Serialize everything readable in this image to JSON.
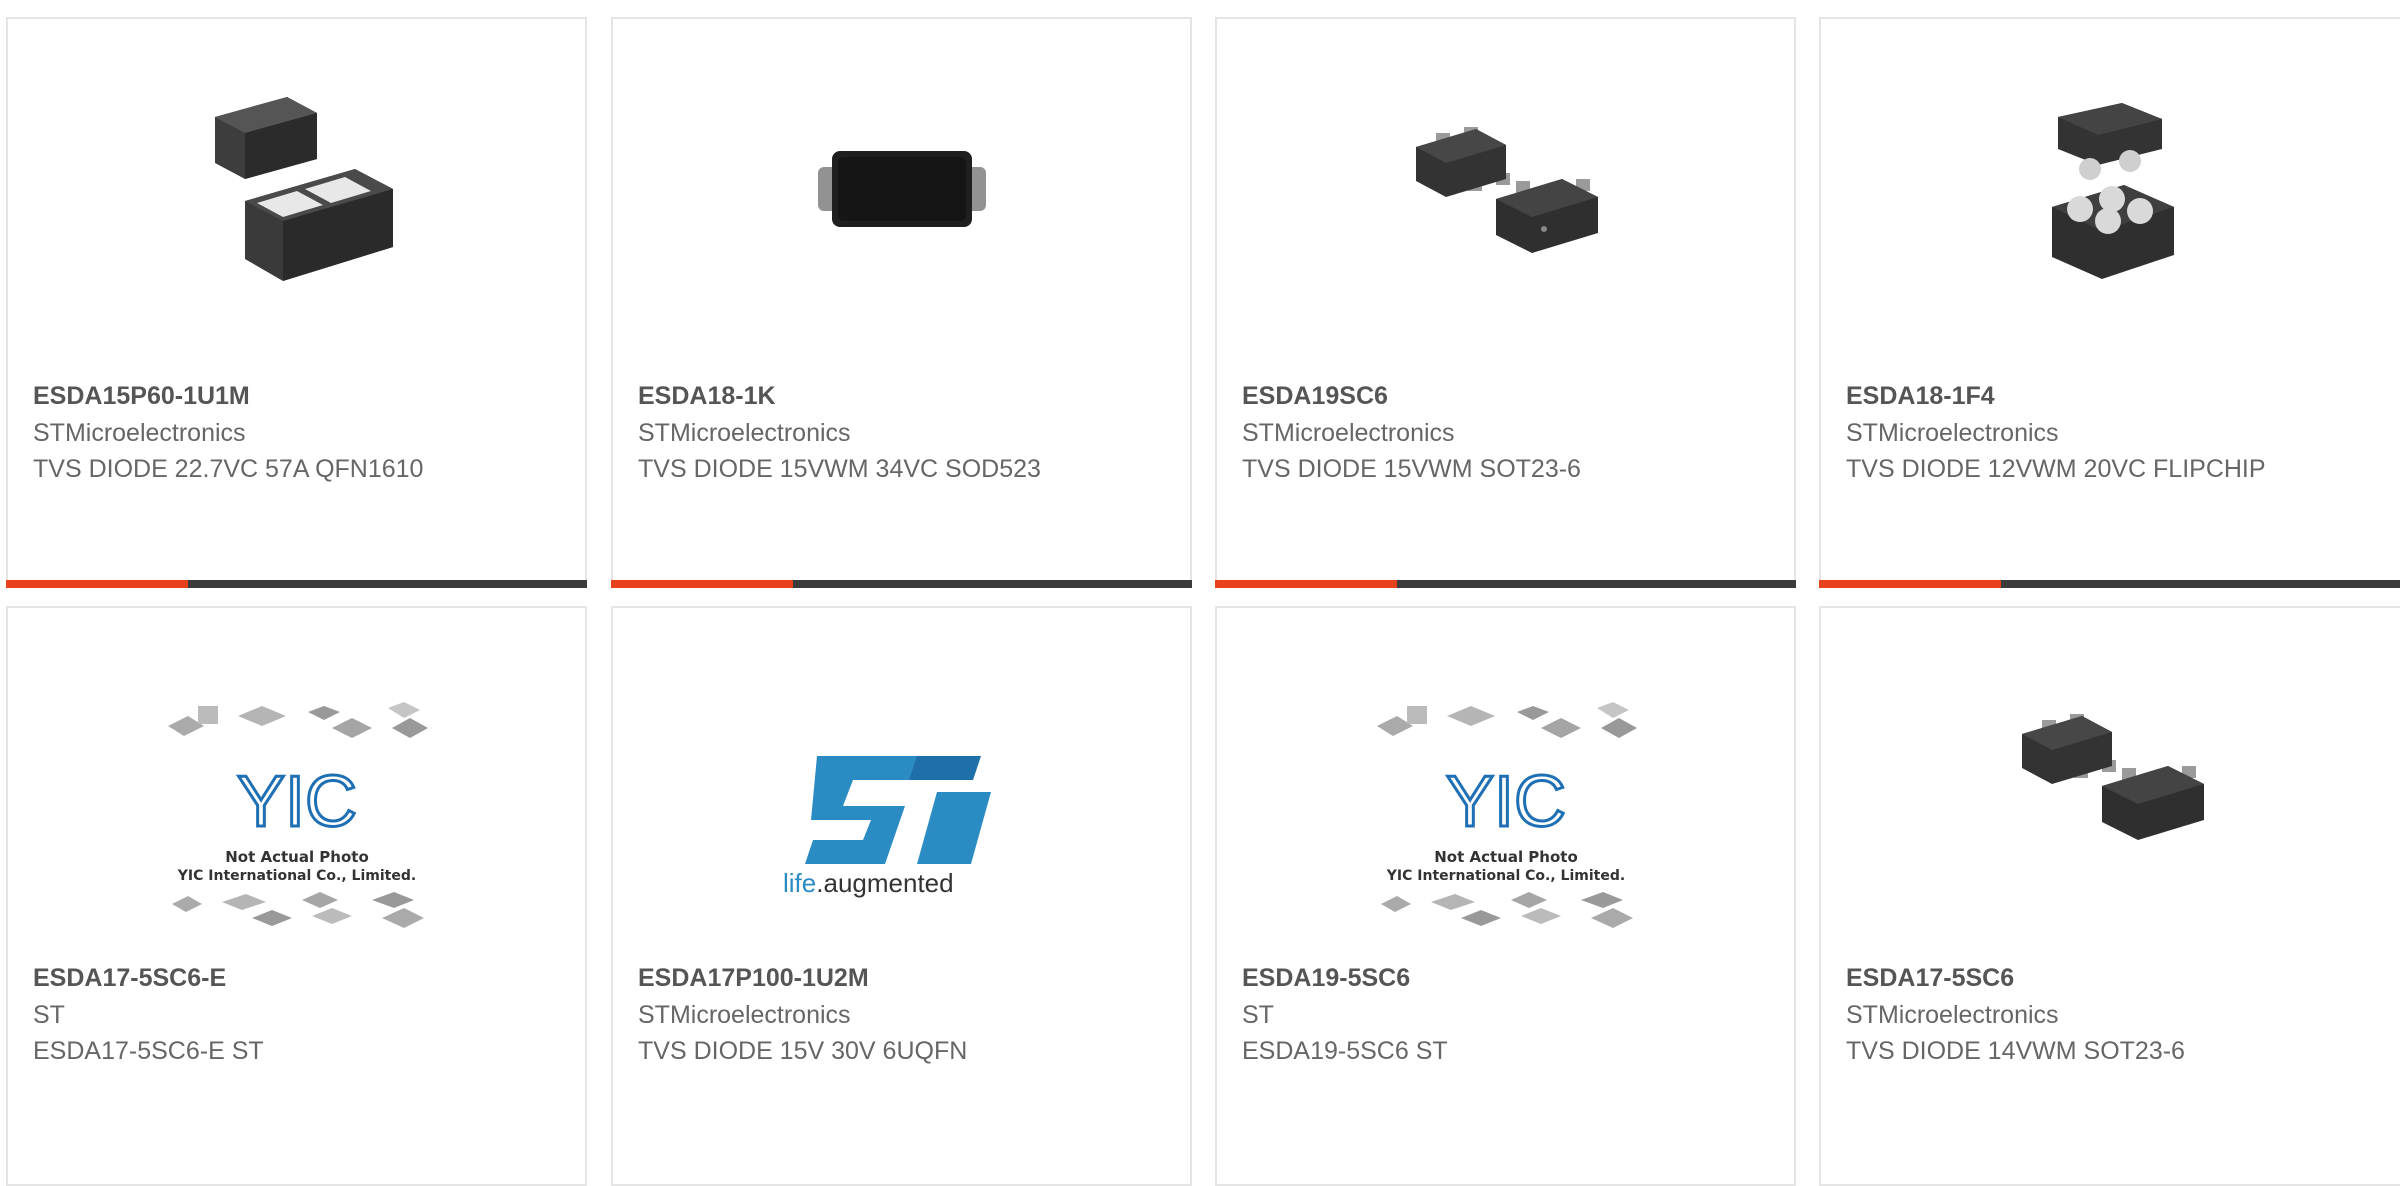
{
  "colors": {
    "accent": "#e8411c",
    "bar_dark": "#3b3b3b",
    "border": "#e5e5e5",
    "st_blue": "#2b8cc4"
  },
  "products": [
    {
      "part_number": "ESDA15P60-1U1M",
      "manufacturer": "STMicroelectronics",
      "description": "TVS DIODE 22.7VC 57A QFN1610",
      "image": "qfn1610-package-icon"
    },
    {
      "part_number": "ESDA18-1K",
      "manufacturer": "STMicroelectronics",
      "description": "TVS DIODE 15VWM 34VC SOD523",
      "image": "sod523-package-icon"
    },
    {
      "part_number": "ESDA19SC6",
      "manufacturer": "STMicroelectronics",
      "description": "TVS DIODE 15VWM SOT23-6",
      "image": "sot23-6-package-icon"
    },
    {
      "part_number": "ESDA18-1F4",
      "manufacturer": "STMicroelectronics",
      "description": "TVS DIODE 12VWM 20VC FLIPCHIP",
      "image": "flipchip-package-icon"
    },
    {
      "part_number": "ESDA17-5SC6-E",
      "manufacturer": "ST",
      "description": "ESDA17-5SC6-E ST",
      "image": "yic-placeholder-icon",
      "placeholder_text": {
        "brand": "YIC",
        "line1": "Not Actual Photo",
        "line2": "YIC International Co., Limited."
      }
    },
    {
      "part_number": "ESDA17P100-1U2M",
      "manufacturer": "STMicroelectronics",
      "description": "TVS DIODE 15V 30V 6UQFN",
      "image": "st-logo-icon",
      "logo_text": {
        "life": "life",
        "dot": ".",
        "augmented": "augmented"
      }
    },
    {
      "part_number": "ESDA19-5SC6",
      "manufacturer": "ST",
      "description": "ESDA19-5SC6 ST",
      "image": "yic-placeholder-icon",
      "placeholder_text": {
        "brand": "YIC",
        "line1": "Not Actual Photo",
        "line2": "YIC International Co., Limited."
      }
    },
    {
      "part_number": "ESDA17-5SC6",
      "manufacturer": "STMicroelectronics",
      "description": "TVS DIODE 14VWM SOT23-6",
      "image": "sot23-6-package-icon"
    }
  ]
}
